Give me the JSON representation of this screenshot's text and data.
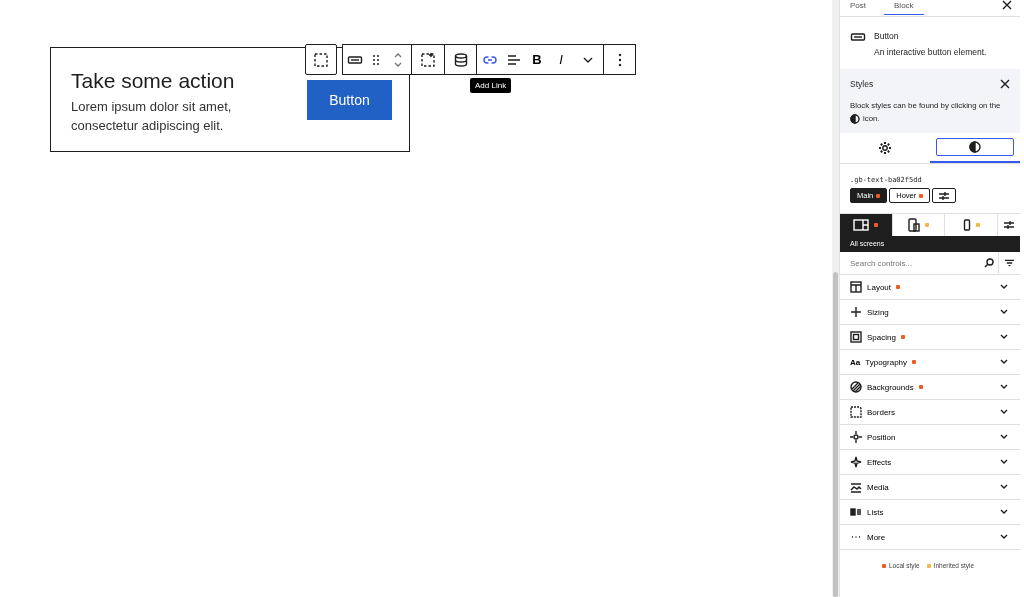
{
  "canvas": {
    "heading": "Take some action",
    "text": "Lorem ipsum dolor sit amet, consectetur adipiscing elit.",
    "button": "Button"
  },
  "toolbar": {
    "bold": "B",
    "italic": "I",
    "tooltip": "Add Link"
  },
  "sidebar": {
    "tabs": [
      {
        "label": "Post",
        "selected": false
      },
      {
        "label": "Block",
        "selected": true
      }
    ],
    "block": {
      "name": "Button",
      "description": "An interactive button element."
    },
    "notice": {
      "title": "Styles",
      "text_before": "Block styles can be found by clicking on the",
      "text_after": "icon."
    },
    "panel_tabs": [
      {
        "kind": "settings",
        "selected": false
      },
      {
        "kind": "styles",
        "selected": true
      }
    ],
    "selector": ".gb-text-ba02f5dd",
    "states": [
      {
        "label": "Main",
        "selected": true,
        "color": "#f05a24"
      },
      {
        "label": "Hover",
        "selected": false,
        "color": "#f05a24"
      }
    ],
    "devices": [
      {
        "kind": "desktop",
        "selected": true,
        "color": "#f05a24"
      },
      {
        "kind": "tablet",
        "selected": false,
        "color": "#f0b849"
      },
      {
        "kind": "mobile",
        "selected": false,
        "color": "#f0b849"
      }
    ],
    "device_label": "All screens",
    "search": {
      "placeholder": "Search controls..."
    },
    "panels": [
      {
        "kind": "layout",
        "label": "Layout",
        "color": "#f05a24"
      },
      {
        "kind": "sizing",
        "label": "Sizing"
      },
      {
        "kind": "spacing",
        "label": "Spacing",
        "color": "#f05a24"
      },
      {
        "kind": "typography",
        "label": "Typography",
        "icon_text": "Aa",
        "color": "#f05a24"
      },
      {
        "kind": "backgrounds",
        "label": "Backgrounds",
        "color": "#f05a24"
      },
      {
        "kind": "borders",
        "label": "Borders"
      },
      {
        "kind": "position",
        "label": "Position"
      },
      {
        "kind": "effects",
        "label": "Effects"
      },
      {
        "kind": "media",
        "label": "Media"
      },
      {
        "kind": "lists",
        "label": "Lists"
      },
      {
        "kind": "more",
        "label": "More"
      }
    ],
    "legend": [
      {
        "label": "Local style",
        "color": "#f05a24"
      },
      {
        "label": "Inherited style",
        "color": "#f0b849"
      }
    ]
  }
}
